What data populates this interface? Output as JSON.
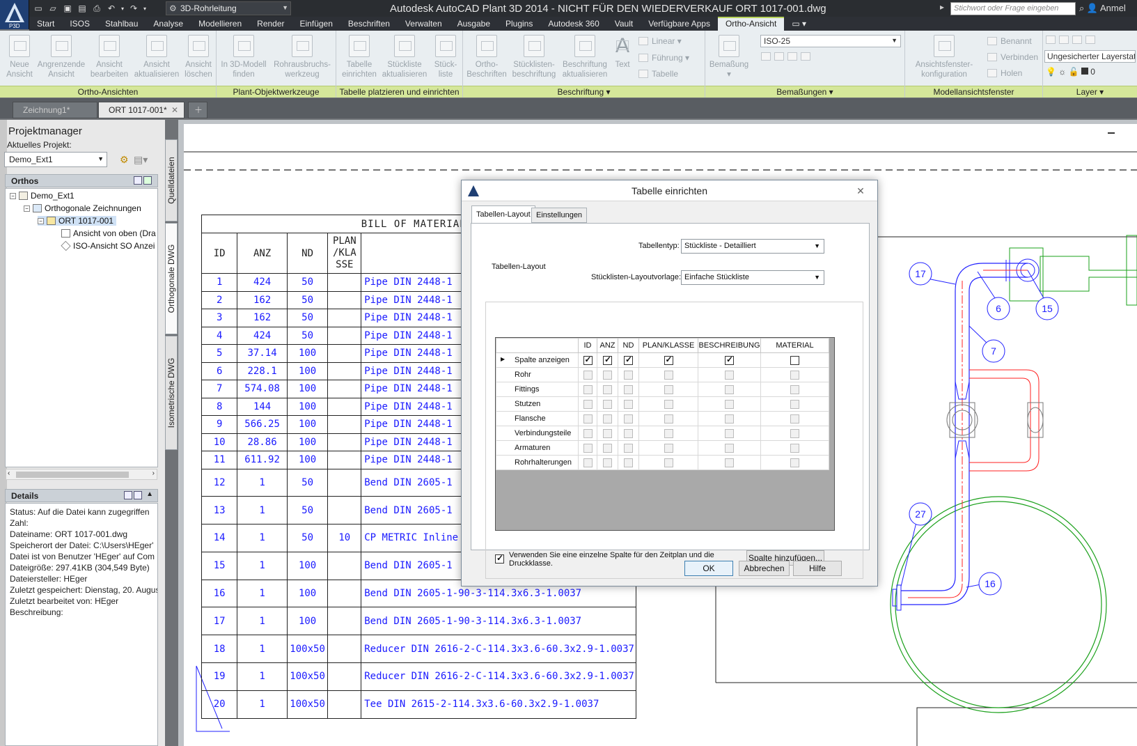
{
  "app": {
    "logo_text": "P3D",
    "workspace": "3D-Rohrleitung",
    "window_title": "Autodesk AutoCAD Plant 3D 2014 - NICHT FÜR DEN WIEDERVERKAUF    ORT 1017-001.dwg",
    "search_placeholder": "Stichwort oder Frage eingeben",
    "login": "Anmel"
  },
  "ribbon_tabs": [
    "Start",
    "ISOS",
    "Stahlbau",
    "Analyse",
    "Modellieren",
    "Render",
    "Einfügen",
    "Beschriften",
    "Verwalten",
    "Ausgabe",
    "Plugins",
    "Autodesk 360",
    "Vault",
    "Verfügbare Apps",
    "Ortho-Ansicht"
  ],
  "ribbon": {
    "groups": {
      "ortho": "Ortho-Ansichten",
      "plant": "Plant-Objektwerkzeuge",
      "table": "Tabelle platzieren und einrichten",
      "label": "Beschriftung",
      "dim": "Bemaßungen",
      "viewport": "Modellansichtsfenster",
      "layer": "Layer"
    },
    "buttons": {
      "new_view": "Neue Ansicht",
      "adj_view": "Angrenzende Ansicht",
      "edit_view": "Ansicht bearbeiten",
      "update_view": "Ansicht aktualisieren",
      "delete_view": "Ansicht löschen",
      "find_3d": "In 3D-Modell finden",
      "pipe_break": "Rohrausbruchs-werkzeug",
      "setup_table": "Tabelle einrichten",
      "update_bom": "Stückliste aktualisieren",
      "part_list": "Stück-liste",
      "ortho_labels": "Ortho-Beschriften",
      "bom_label": "Stücklisten-beschriftung",
      "update_label": "Beschriftung aktualisieren",
      "text": "Text",
      "linear": "Linear",
      "leader": "Führung",
      "table": "Tabelle",
      "dimension": "Bemaßung",
      "dimstyle": "ISO-25",
      "vp_config": "Ansichtsfenster-konfiguration",
      "named": "Benannt",
      "join": "Verbinden",
      "restore": "Holen",
      "layer_state": "Ungesicherter Layerstatus",
      "layer_zero": "0"
    }
  },
  "doc_tabs": [
    {
      "label": "Zeichnung1*",
      "active": false
    },
    {
      "label": "ORT 1017-001*",
      "active": true
    }
  ],
  "project_manager": {
    "title": "Projektmanager",
    "current_label": "Aktuelles Projekt:",
    "project": "Demo_Ext1",
    "orthos_head": "Orthos",
    "tree": {
      "root": "Demo_Ext1",
      "folder": "Orthogonale Zeichnungen",
      "drawing": "ORT 1017-001",
      "view1": "Ansicht von oben (Dra",
      "view2": "ISO-Ansicht SO Anzei"
    },
    "details_head": "Details",
    "details": [
      "Status: Auf die Datei kann zugegriffen",
      "Zahl:",
      "Dateiname: ORT 1017-001.dwg",
      "Speicherort  der  Datei:  C:\\Users\\HEger'",
      "Datei ist von Benutzer 'HEger' auf Com",
      "Dateigröße: 297.41KB (304,549 Byte)",
      "Dateiersteller:  HEger",
      "Zuletzt gespeichert: Dienstag, 20. Augus",
      "Zuletzt bearbeitet von:  HEger",
      "Beschreibung:"
    ],
    "side_tabs": [
      "Quelldateien",
      "Orthogonale DWG",
      "Isometrische DWG"
    ]
  },
  "bom": {
    "title": "BILL OF MATERIALS",
    "headers": [
      "ID",
      "ANZ",
      "ND",
      "PLAN /KLA SSE",
      ""
    ],
    "rows": [
      [
        "1",
        "424",
        "50",
        "",
        "Pipe DIN 2448-1"
      ],
      [
        "2",
        "162",
        "50",
        "",
        "Pipe DIN 2448-1"
      ],
      [
        "3",
        "162",
        "50",
        "",
        "Pipe DIN 2448-1"
      ],
      [
        "4",
        "424",
        "50",
        "",
        "Pipe DIN 2448-1"
      ],
      [
        "5",
        "37.14",
        "100",
        "",
        "Pipe DIN 2448-1"
      ],
      [
        "6",
        "228.1",
        "100",
        "",
        "Pipe DIN 2448-1"
      ],
      [
        "7",
        "574.08",
        "100",
        "",
        "Pipe DIN 2448-1"
      ],
      [
        "8",
        "144",
        "100",
        "",
        "Pipe DIN 2448-1"
      ],
      [
        "9",
        "566.25",
        "100",
        "",
        "Pipe DIN 2448-1"
      ],
      [
        "10",
        "28.86",
        "100",
        "",
        "Pipe DIN 2448-1"
      ],
      [
        "11",
        "611.92",
        "100",
        "",
        "Pipe DIN 2448-1"
      ],
      [
        "12",
        "1",
        "50",
        "",
        "Bend DIN 2605-1"
      ],
      [
        "13",
        "1",
        "50",
        "",
        "Bend DIN 2605-1"
      ],
      [
        "14",
        "1",
        "50",
        "10",
        "CP METRIC Inline"
      ],
      [
        "15",
        "1",
        "100",
        "",
        "Bend DIN 2605-1"
      ],
      [
        "16",
        "1",
        "100",
        "",
        "Bend DIN 2605-1-90-3-114.3x6.3-1.0037"
      ],
      [
        "17",
        "1",
        "100",
        "",
        "Bend DIN 2605-1-90-3-114.3x6.3-1.0037"
      ],
      [
        "18",
        "1",
        "100x50",
        "",
        "Reducer DIN 2616-2-C-114.3x3.6-60.3x2.9-1.0037"
      ],
      [
        "19",
        "1",
        "100x50",
        "",
        "Reducer DIN 2616-2-C-114.3x3.6-60.3x2.9-1.0037"
      ],
      [
        "20",
        "1",
        "100x50",
        "",
        "Tee DIN 2615-2-114.3x3.6-60.3x2.9-1.0037"
      ]
    ]
  },
  "balloons": [
    "17",
    "6",
    "15",
    "7",
    "27",
    "16"
  ],
  "dialog": {
    "title": "Tabelle einrichten",
    "tabs": [
      "Tabellen-Layout",
      "Einstellungen"
    ],
    "table_type_label": "Tabellentyp:",
    "table_type": "Stückliste - Detailliert",
    "group_label": "Tabellen-Layout",
    "template_label": "Stücklisten-Layoutvorlage:",
    "template": "Einfache Stückliste",
    "grid_columns": [
      "ID",
      "ANZ",
      "ND",
      "PLAN/KLASSE",
      "BESCHREIBUNG",
      "MATERIAL"
    ],
    "grid_rows": [
      {
        "label": "Spalte anzeigen",
        "values": [
          true,
          true,
          true,
          true,
          true,
          false
        ],
        "enabled": true
      },
      {
        "label": "Rohr",
        "values": [
          false,
          false,
          false,
          false,
          false,
          false
        ],
        "enabled": false
      },
      {
        "label": "Fittings",
        "values": [
          false,
          false,
          false,
          false,
          false,
          false
        ],
        "enabled": false
      },
      {
        "label": "Stutzen",
        "values": [
          false,
          false,
          false,
          false,
          false,
          false
        ],
        "enabled": false
      },
      {
        "label": "Flansche",
        "values": [
          false,
          false,
          false,
          false,
          false,
          false
        ],
        "enabled": false
      },
      {
        "label": "Verbindungsteile",
        "values": [
          false,
          false,
          false,
          false,
          false,
          false
        ],
        "enabled": false
      },
      {
        "label": "Armaturen",
        "values": [
          false,
          false,
          false,
          false,
          false,
          false
        ],
        "enabled": false
      },
      {
        "label": "Rohrhalterungen",
        "values": [
          false,
          false,
          false,
          false,
          false,
          false
        ],
        "enabled": false
      }
    ],
    "single_column_text": "Verwenden Sie eine einzelne Spalte für den Zeitplan und die Druckklasse.",
    "single_column_checked": true,
    "add_column": "Spalte hinzufügen...",
    "ok": "OK",
    "cancel": "Abbrechen",
    "help": "Hilfe"
  }
}
